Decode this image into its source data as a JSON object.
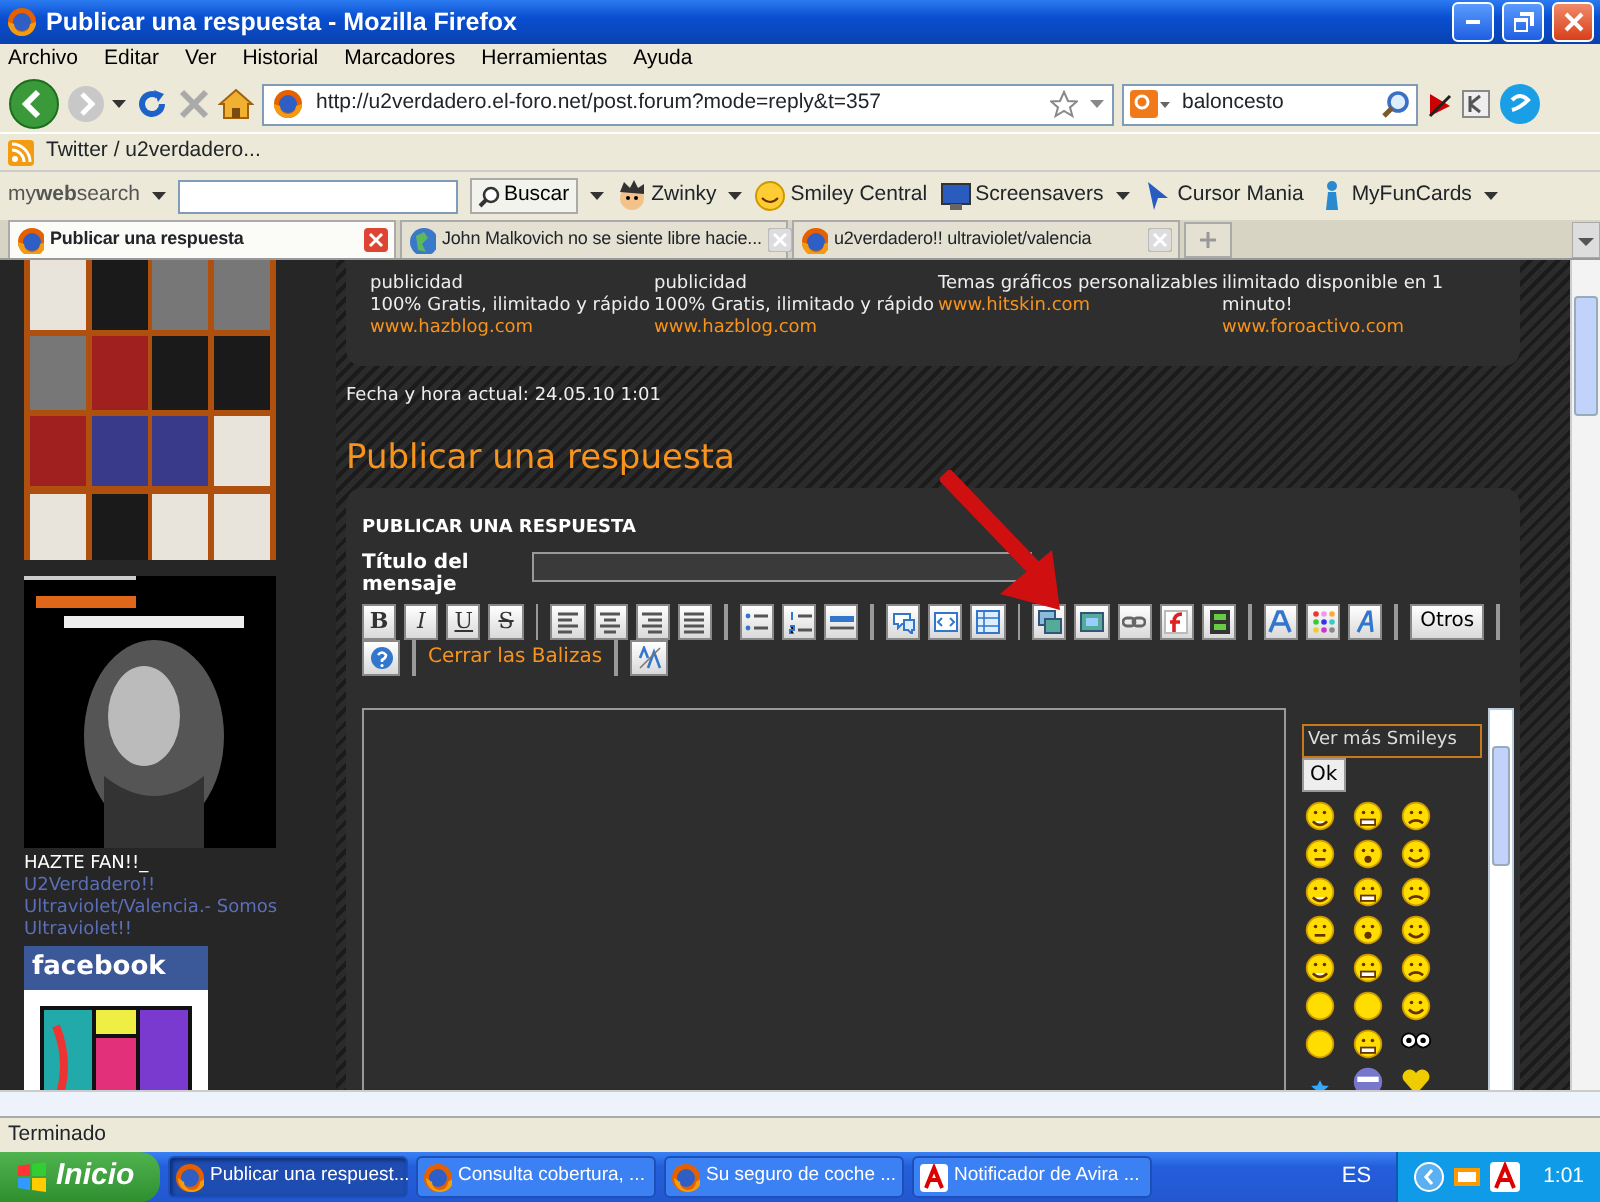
{
  "window": {
    "title": "Publicar una respuesta - Mozilla Firefox"
  },
  "menu": [
    "Archivo",
    "Editar",
    "Ver",
    "Historial",
    "Marcadores",
    "Herramientas",
    "Ayuda"
  ],
  "navigation": {
    "url": "http://u2verdadero.el-foro.net/post.forum?mode=reply&t=357",
    "search": "baloncesto"
  },
  "bookmarks": [
    "Twitter / u2verdadero..."
  ],
  "search_toolbar": {
    "logo": "my**web**search",
    "button": "Buscar",
    "items": [
      "Zwinky",
      "Smiley Central",
      "Screensavers",
      "Cursor Mania",
      "MyFunCards"
    ]
  },
  "tabs": [
    {
      "label": "Publicar una respuesta",
      "selected": true
    },
    {
      "label": "John Malkovich no se siente libre hacie...",
      "selected": false
    },
    {
      "label": "u2verdadero!! ultraviolet/valencia",
      "selected": false
    }
  ],
  "sidebar": {
    "fan_text": "HAZTE FAN!!_",
    "fan_link": "U2Verdadero!! Ultraviolet/Valencia.- Somos Ultraviolet!!",
    "facebook": "facebook"
  },
  "ads": [
    {
      "lines": [
        "publicidad",
        "100% Gratis, ilimitado y rápido"
      ],
      "link": "www.hazblog.com"
    },
    {
      "lines": [
        "publicidad",
        "100% Gratis, ilimitado y rápido"
      ],
      "link": "www.hazblog.com"
    },
    {
      "lines": [
        "Temas gráficos personalizables"
      ],
      "link": "www.hitskin.com"
    },
    {
      "lines": [
        "ilimitado disponible en 1",
        "minuto!"
      ],
      "link": "www.foroactivo.com"
    }
  ],
  "date_line": "Fecha y hora actual: 24.05.10 1:01",
  "page_title": "Publicar una respuesta",
  "form": {
    "heading": "PUBLICAR UNA RESPUESTA",
    "subject_label": "Título del mensaje",
    "toolbar_rows": [
      [
        {
          "kind": "letter",
          "label": "B"
        },
        {
          "kind": "letter",
          "label": "I"
        },
        {
          "kind": "letter",
          "label": "U"
        },
        {
          "kind": "letter",
          "label": "S"
        },
        {
          "kind": "separator"
        },
        {
          "kind": "icon"
        },
        {
          "kind": "icon"
        },
        {
          "kind": "icon"
        },
        {
          "kind": "icon"
        },
        {
          "kind": "separator"
        },
        {
          "kind": "icon"
        },
        {
          "kind": "icon"
        },
        {
          "kind": "icon"
        },
        {
          "kind": "separator"
        },
        {
          "kind": "icon"
        },
        {
          "kind": "icon"
        },
        {
          "kind": "icon"
        },
        {
          "kind": "separator"
        },
        {
          "kind": "icon"
        },
        {
          "kind": "icon"
        },
        {
          "kind": "icon"
        },
        {
          "kind": "icon"
        },
        {
          "kind": "icon"
        },
        {
          "kind": "separator"
        },
        {
          "kind": "icon"
        },
        {
          "kind": "icon"
        },
        {
          "kind": "icon"
        },
        {
          "kind": "separator"
        },
        {
          "kind": "button",
          "label": "Otros"
        },
        {
          "kind": "separator"
        }
      ],
      [
        {
          "kind": "icon"
        },
        {
          "kind": "separator"
        },
        {
          "kind": "link",
          "label": "Cerrar las Balizas"
        },
        {
          "kind": "separator"
        },
        {
          "kind": "icon"
        }
      ]
    ],
    "smileys": {
      "select": "Ver más Smileys",
      "button": "Ok"
    }
  },
  "status_bar": "Terminado",
  "taskbar": {
    "start": "Inicio",
    "tasks": [
      {
        "label": "Publicar una respuest...",
        "selected": true
      },
      {
        "label": "Consulta cobertura, ...",
        "selected": false
      },
      {
        "label": "Su seguro de coche ...",
        "selected": false
      },
      {
        "label": "Notificador de Avira ...",
        "selected": false
      }
    ],
    "language": "ES",
    "clock": "1:01"
  }
}
